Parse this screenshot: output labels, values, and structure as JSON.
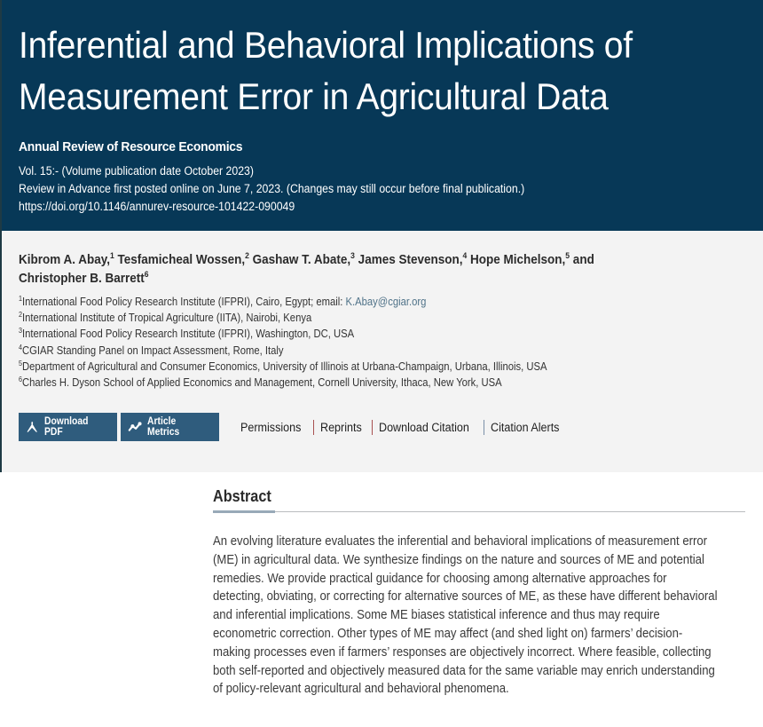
{
  "header": {
    "title": "Inferential and Behavioral Implications of Measurement Error in Agricultural Data",
    "journal": "Annual Review of Resource Economics",
    "volume_line": "Vol. 15:- (Volume publication date October 2023)",
    "advance_line": "Review in Advance first posted online on June 7, 2023. (Changes may still occur before final publication.)",
    "doi": "https://doi.org/10.1146/annurev-resource-101422-090049"
  },
  "authors": [
    {
      "name": "Kibrom A. Abay,",
      "sup": "1"
    },
    {
      "name": "Tesfamicheal Wossen,",
      "sup": "2"
    },
    {
      "name": "Gashaw T. Abate,",
      "sup": "3"
    },
    {
      "name": "James Stevenson,",
      "sup": "4"
    },
    {
      "name": "Hope Michelson,",
      "sup": "5"
    },
    {
      "name": "and",
      "sup": ""
    },
    {
      "name": "Christopher B. Barrett",
      "sup": "6"
    }
  ],
  "affiliations": [
    {
      "sup": "1",
      "text": "International Food Policy Research Institute (IFPRI), Cairo, Egypt; email: ",
      "email": "K.Abay@cgiar.org"
    },
    {
      "sup": "2",
      "text": "International Institute of Tropical Agriculture (IITA), Nairobi, Kenya"
    },
    {
      "sup": "3",
      "text": "International Food Policy Research Institute (IFPRI), Washington, DC, USA"
    },
    {
      "sup": "4",
      "text": "CGIAR Standing Panel on Impact Assessment, Rome, Italy"
    },
    {
      "sup": "5",
      "text": "Department of Agricultural and Consumer Economics, University of Illinois at Urbana-Champaign, Urbana, Illinois, USA"
    },
    {
      "sup": "6",
      "text": "Charles H. Dyson School of Applied Economics and Management, Cornell University, Ithaca, New York, USA"
    }
  ],
  "actions": {
    "download_pdf": {
      "label": "Download PDF",
      "icon": "pdf-icon"
    },
    "article_metrics": {
      "label": "Article Metrics",
      "icon": "metrics-icon"
    },
    "links": [
      "Permissions",
      "Reprints",
      "Download Citation",
      "Citation Alerts"
    ]
  },
  "abstract": {
    "heading": "Abstract",
    "body": "An evolving literature evaluates the inferential and behavioral implications of measurement error (ME) in agricultural data. We synthesize findings on the nature and sources of ME and potential remedies. We provide practical guidance for choosing among alternative approaches for detecting, obviating, or correcting for alternative sources of ME, as these have different behavioral and inferential implications. Some ME biases statistical inference and thus may require econometric correction. Other types of ME may affect (and shed light on) farmers’ decision-making processes even if farmers’ responses are objectively incorrect. Where feasible, collecting both self-reported and objectively measured data for the same variable may enrich understanding of policy-relevant agricultural and behavioral phenomena."
  },
  "colors": {
    "banner_bg": "#073857",
    "panel_bg": "#f3f3f3",
    "button_bg": "#2f5c7d",
    "email_link": "#4f7288"
  }
}
